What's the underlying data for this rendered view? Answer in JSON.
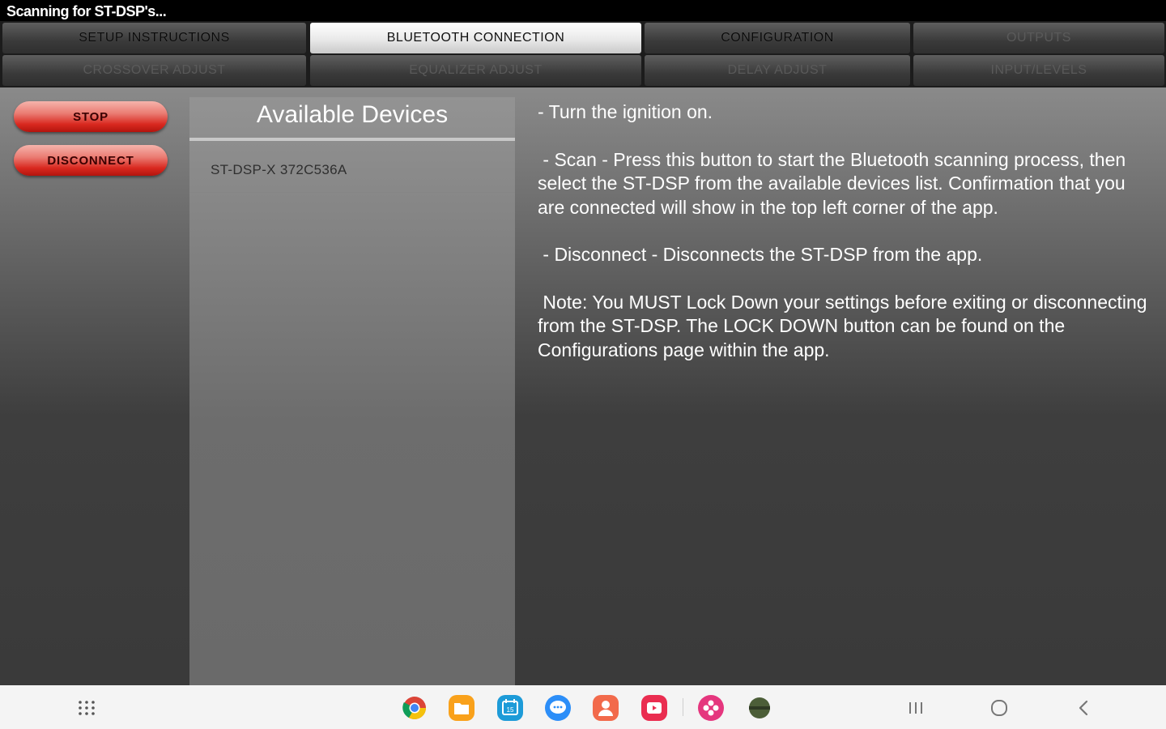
{
  "status": {
    "text": "Scanning for ST-DSP's..."
  },
  "tabs": [
    {
      "label": "SETUP INSTRUCTIONS",
      "state": "enabled"
    },
    {
      "label": "BLUETOOTH CONNECTION",
      "state": "active"
    },
    {
      "label": "CONFIGURATION",
      "state": "enabled"
    },
    {
      "label": "OUTPUTS",
      "state": "disabled"
    },
    {
      "label": "CROSSOVER ADJUST",
      "state": "disabled"
    },
    {
      "label": "EQUALIZER ADJUST",
      "state": "disabled"
    },
    {
      "label": "DELAY ADJUST",
      "state": "disabled"
    },
    {
      "label": "INPUT/LEVELS",
      "state": "disabled"
    }
  ],
  "buttons": {
    "stop": "STOP",
    "disconnect": "DISCONNECT"
  },
  "devices": {
    "title": "Available Devices",
    "items": [
      "ST-DSP-X 372C536A"
    ]
  },
  "instructions": {
    "p1": "- Turn the ignition on.",
    "p2": " - Scan - Press this button to start the Bluetooth scanning process, then select the ST-DSP from the available devices list. Confirmation that you are connected will show in the top left corner of the app.",
    "p3": " - Disconnect - Disconnects the ST-DSP from the app.",
    "p4": " Note: You MUST Lock Down your settings before exiting or disconnecting from the ST-DSP. The LOCK DOWN button can be found on the Configurations page within the app."
  },
  "dock": {
    "apps": [
      "chrome-icon",
      "files-icon",
      "calendar-icon",
      "messages-icon",
      "contacts-icon",
      "video-icon",
      "gallery-icon",
      "game-icon"
    ],
    "colors": {
      "files": "#f9a11b",
      "calendar": "#1d9bd8",
      "messages": "#2c8ef8",
      "contacts": "#f26a4b",
      "video": "#ea2d50",
      "gallery": "#e5367e",
      "game": "#4c5e38"
    }
  }
}
